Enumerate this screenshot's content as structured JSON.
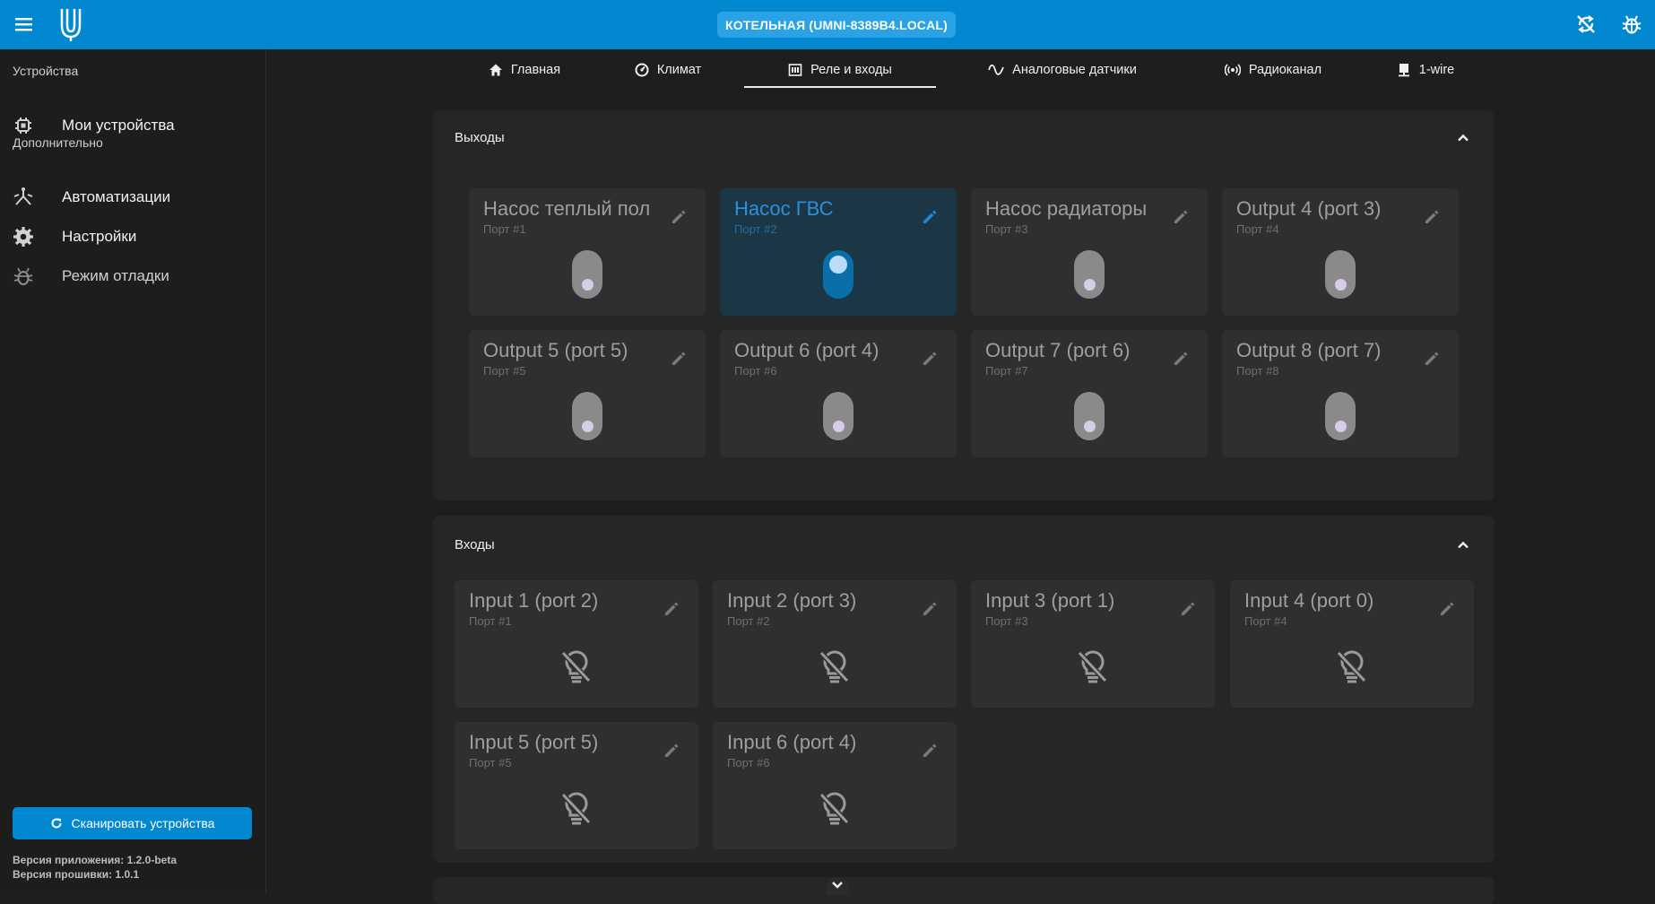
{
  "header": {
    "device_name": "КОТЕЛЬНАЯ (UMNI-8389B4.LOCAL)",
    "icons": [
      "menu-icon",
      "app-logo",
      "sync-off-icon",
      "bug-icon"
    ]
  },
  "sidebar": {
    "section_devices": "Устройства",
    "my_devices": "Мои устройства",
    "section_extra": "Дополнительно",
    "automations": "Автоматизации",
    "settings": "Настройки",
    "debug_mode": "Режим отладки",
    "scan_button": "Сканировать устройства",
    "app_version": "Версия приложения: 1.2.0-beta",
    "firmware_version": "Версия прошивки: 1.0.1"
  },
  "tabs": [
    {
      "label": "Главная",
      "icon": "home-icon"
    },
    {
      "label": "Климат",
      "icon": "gauge-icon"
    },
    {
      "label": "Реле и входы",
      "icon": "relay-icon",
      "active": true
    },
    {
      "label": "Аналоговые датчики",
      "icon": "sine-wave-icon"
    },
    {
      "label": "Радиоканал",
      "icon": "radio-icon"
    },
    {
      "label": "1-wire",
      "icon": "one-wire-icon"
    }
  ],
  "outputs": {
    "title": "Выходы",
    "items": [
      {
        "name": "Насос теплый пол",
        "port": "Порт #1",
        "on": false
      },
      {
        "name": "Насос ГВС",
        "port": "Порт #2",
        "on": true
      },
      {
        "name": "Насос радиаторы",
        "port": "Порт #3",
        "on": false
      },
      {
        "name": "Output 4 (port 3)",
        "port": "Порт #4",
        "on": false
      },
      {
        "name": "Output 5 (port 5)",
        "port": "Порт #5",
        "on": false
      },
      {
        "name": "Output 6 (port 4)",
        "port": "Порт #6",
        "on": false
      },
      {
        "name": "Output 7 (port 6)",
        "port": "Порт #7",
        "on": false
      },
      {
        "name": "Output 8 (port 7)",
        "port": "Порт #8",
        "on": false
      }
    ]
  },
  "inputs": {
    "title": "Входы",
    "items": [
      {
        "name": "Input 1 (port 2)",
        "port": "Порт #1"
      },
      {
        "name": "Input 2 (port 3)",
        "port": "Порт #2"
      },
      {
        "name": "Input 3 (port 1)",
        "port": "Порт #3"
      },
      {
        "name": "Input 4 (port 0)",
        "port": "Порт #4"
      },
      {
        "name": "Input 5 (port 5)",
        "port": "Порт #5"
      },
      {
        "name": "Input 6 (port 4)",
        "port": "Порт #6"
      }
    ]
  },
  "colors": {
    "accent": "#0288d1",
    "background": "#1e1e1e",
    "card": "#2e2f31",
    "card_active": "#1b3746"
  }
}
